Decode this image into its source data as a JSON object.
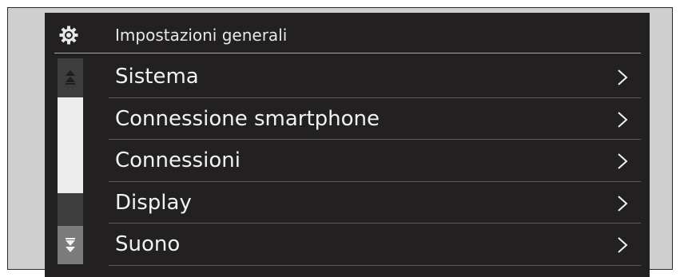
{
  "header": {
    "title": "Impostazioni generali",
    "icon": "gear-icon"
  },
  "menu": {
    "items": [
      {
        "label": "Sistema",
        "icon": "chevron-right-icon"
      },
      {
        "label": "Connessione smartphone",
        "icon": "chevron-right-icon"
      },
      {
        "label": "Connessioni",
        "icon": "chevron-right-icon"
      },
      {
        "label": "Display",
        "icon": "chevron-right-icon"
      },
      {
        "label": "Suono",
        "icon": "chevron-right-icon"
      }
    ]
  },
  "scrollbar": {
    "up_icon": "double-chevron-up-icon",
    "down_icon": "double-chevron-down-icon",
    "up_enabled": false,
    "down_enabled": true
  },
  "colors": {
    "screen_background": "#222020",
    "text": "#f2f2f2",
    "divider": "#5a5a5a",
    "frame_background": "#cfcfcf"
  }
}
